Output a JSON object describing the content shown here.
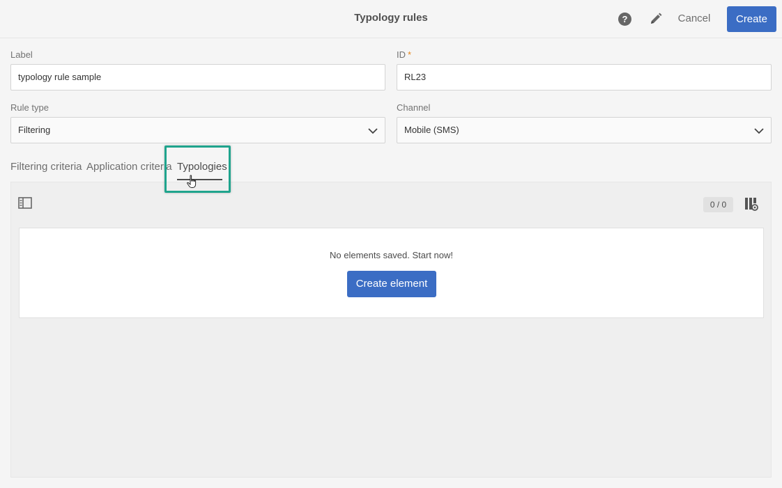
{
  "header": {
    "title": "Typology rules",
    "cancel_label": "Cancel",
    "create_label": "Create",
    "help_glyph": "?"
  },
  "form": {
    "label": {
      "caption": "Label",
      "value": "typology rule sample"
    },
    "id": {
      "caption": "ID",
      "required_mark": "*",
      "value": "RL23"
    },
    "rule_type": {
      "caption": "Rule type",
      "selected": "Filtering"
    },
    "channel": {
      "caption": "Channel",
      "selected": "Mobile (SMS)"
    }
  },
  "tabs": [
    {
      "label": "Filtering criteria",
      "active": false
    },
    {
      "label": "Application criteria",
      "active": false
    },
    {
      "label": "Typologies",
      "active": true
    }
  ],
  "panel": {
    "count": "0 / 0",
    "empty_message": "No elements saved. Start now!",
    "create_element_label": "Create element"
  },
  "icons": {
    "help": "help-icon",
    "edit": "pencil-icon",
    "chevron": "chevron-down-icon",
    "sidebar_toggle": "sidebar-toggle-icon",
    "column_settings": "column-settings-icon",
    "cursor": "hand-cursor-icon"
  },
  "colors": {
    "primary": "#3b6dc4",
    "highlight": "#1fa48d",
    "required": "#e68619"
  }
}
